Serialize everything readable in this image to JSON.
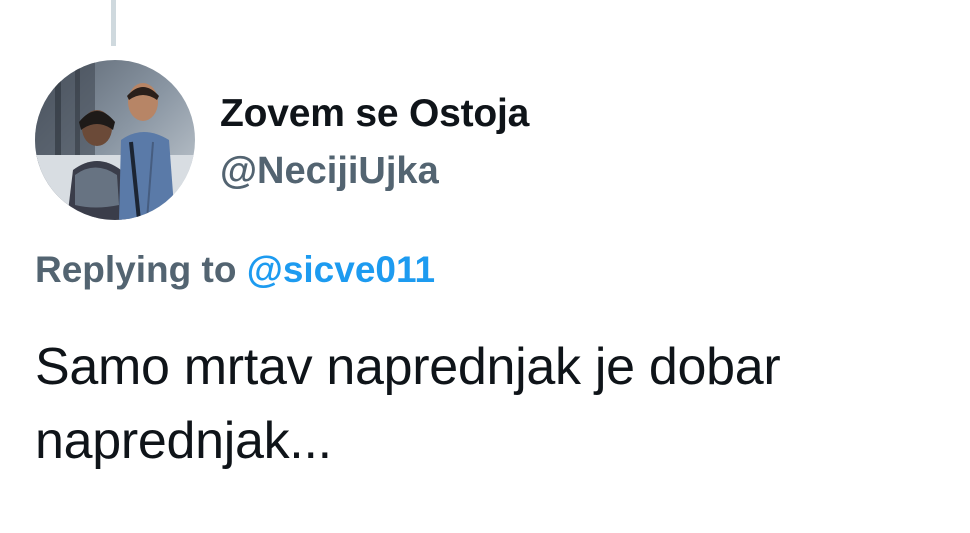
{
  "tweet": {
    "author": {
      "display_name": "Zovem se Ostoja",
      "handle": "@NecijiUjka",
      "avatar_icon": "profile-photo"
    },
    "reply": {
      "prefix": "Replying to",
      "mention": "@sicve011"
    },
    "text": "Samo mrtav naprednjak je dobar naprednjak..."
  },
  "colors": {
    "primary_text": "#0f1419",
    "secondary_text": "#536471",
    "link": "#1d9bf0",
    "thread_line": "#cfd9de",
    "background": "#ffffff"
  }
}
